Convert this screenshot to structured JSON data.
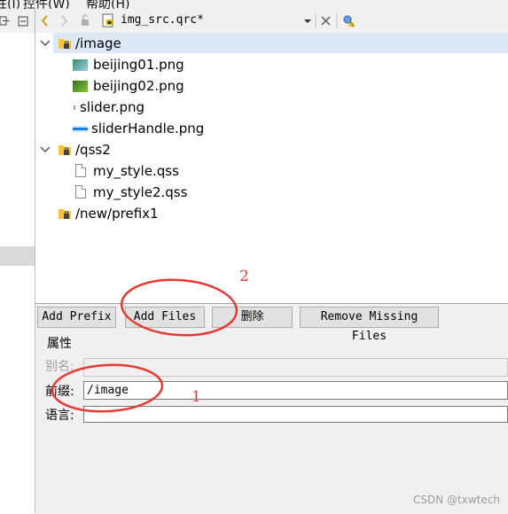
{
  "menubar": {
    "item1": "性(I)",
    "item2": "控件(W)",
    "item3": "帮助(H)"
  },
  "toolbar": {
    "file_title": "img_src.qrc*",
    "icons": [
      "back-arrow-icon",
      "forward-arrow-icon",
      "lock-icon",
      "qrc-file-icon",
      "dropdown-icon",
      "close-icon",
      "find-icon"
    ]
  },
  "tree": {
    "prefixes": [
      {
        "label": "/image",
        "expanded": true,
        "selected": true,
        "files": [
          {
            "label": "beijing01.png",
            "icon": "image-icon"
          },
          {
            "label": "beijing02.png",
            "icon": "image-icon"
          },
          {
            "label": "slider.png",
            "icon": "image-icon"
          },
          {
            "label": "sliderHandle.png",
            "icon": "image-icon"
          }
        ]
      },
      {
        "label": "/qss2",
        "expanded": true,
        "files": [
          {
            "label": "my_style.qss",
            "icon": "file-icon"
          },
          {
            "label": "my_style2.qss",
            "icon": "file-icon"
          }
        ]
      },
      {
        "label": "/new/prefix1",
        "expanded": false,
        "files": []
      }
    ]
  },
  "buttons": {
    "add_prefix": "Add Prefix",
    "add_files": "Add Files",
    "delete": "删除",
    "remove_missing": "Remove Missing Files"
  },
  "properties": {
    "group_title": "属性",
    "alias_label": "别名:",
    "alias_value": "",
    "prefix_label": "前缀:",
    "prefix_value": "/image",
    "language_label": "语言:",
    "language_value": ""
  },
  "annotations": {
    "mark1": "1",
    "mark2": "2",
    "color": "#e53935"
  },
  "watermark": "CSDN @txwtech",
  "colors": {
    "selection": "#dde8f6",
    "panel": "#f0f0f0",
    "annotation": "#e53935"
  }
}
